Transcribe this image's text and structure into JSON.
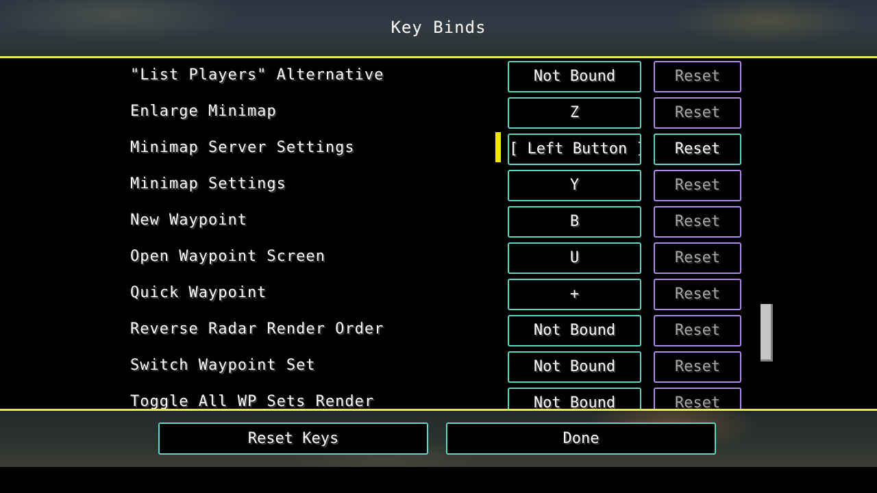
{
  "screen": {
    "title": "Key Binds"
  },
  "bindings": [
    {
      "action": "\"List Players\" Alternative",
      "key": "Not Bound",
      "reset": "Reset",
      "active": false
    },
    {
      "action": "Enlarge Minimap",
      "key": "Z",
      "reset": "Reset",
      "active": false
    },
    {
      "action": "Minimap Server Settings",
      "key": "[ Left Button ]",
      "reset": "Reset",
      "active": true
    },
    {
      "action": "Minimap Settings",
      "key": "Y",
      "reset": "Reset",
      "active": false
    },
    {
      "action": "New Waypoint",
      "key": "B",
      "reset": "Reset",
      "active": false
    },
    {
      "action": "Open Waypoint Screen",
      "key": "U",
      "reset": "Reset",
      "active": false
    },
    {
      "action": "Quick Waypoint",
      "key": "+",
      "reset": "Reset",
      "active": false
    },
    {
      "action": "Reverse Radar Render Order",
      "key": "Not Bound",
      "reset": "Reset",
      "active": false
    },
    {
      "action": "Switch Waypoint Set",
      "key": "Not Bound",
      "reset": "Reset",
      "active": false
    },
    {
      "action": "Toggle All WP Sets Render",
      "key": "Not Bound",
      "reset": "Reset",
      "active": false
    }
  ],
  "footer": {
    "reset_keys_label": "Reset Keys",
    "done_label": "Done"
  },
  "colors": {
    "accent_rule": "#e8e85a",
    "button_border": "#5fd6c6",
    "reset_border_inactive": "#b08ae8",
    "listening_marker": "#f0e600"
  }
}
